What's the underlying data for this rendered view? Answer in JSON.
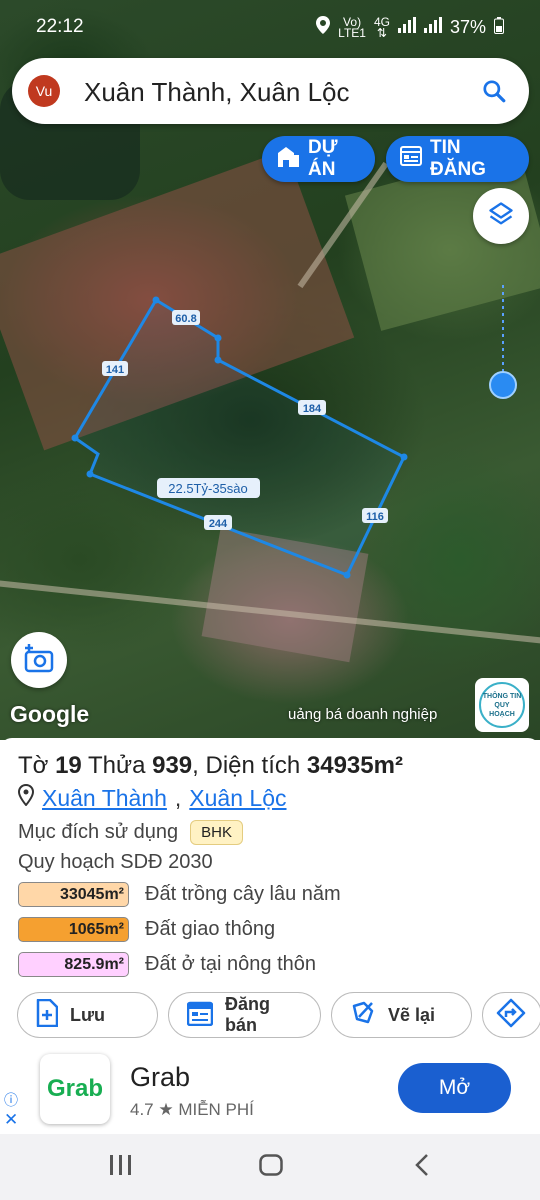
{
  "status": {
    "time": "22:12",
    "volte": "Vo)",
    "lte": "LTE1",
    "net": "4G",
    "battery": "37%"
  },
  "search": {
    "avatar": "Vu",
    "title": "Xuân Thành, Xuân Lộc",
    "icon": "search-icon"
  },
  "chips": {
    "project": "DỰ ÁN",
    "listing": "TIN ĐĂNG"
  },
  "map": {
    "edges": [
      "60.8",
      "141",
      "184",
      "116",
      "244"
    ],
    "parcel_label": "22.5Tỷ-35sào",
    "google": "Google",
    "ad_text": "uảng bá doanh nghiệp",
    "badge": "THÔNG TIN QUY HOẠCH",
    "parcel_color": "#1e88e5"
  },
  "parcel": {
    "sheet_label": "Tờ",
    "sheet": "19",
    "plot_label": "Thửa",
    "plot": "939",
    "area_label": "Diện tích",
    "area": "34935m²",
    "commune": "Xuân Thành",
    "district": "Xuân Lộc",
    "purpose_label": "Mục đích sử dụng",
    "purpose": "BHK",
    "plan_label": "Quy hoạch SDĐ 2030",
    "land_uses": [
      {
        "area": "33045m²",
        "label": "Đất trồng cây lâu năm",
        "color": "#ffd7a8"
      },
      {
        "area": "1065m²",
        "label": "Đất giao thông",
        "color": "#f5a030"
      },
      {
        "area": "825.9m²",
        "label": "Đất ở tại nông thôn",
        "color": "#ffd0ff"
      }
    ]
  },
  "actions": {
    "save": "Lưu",
    "sell": "Đăng bán",
    "redraw": "Vẽ lại"
  },
  "ad": {
    "logo": "Grab",
    "name": "Grab",
    "rating": "4.7 ★  MIỄN PHÍ",
    "open": "Mở",
    "info": "ⓘ",
    "close": "✕"
  },
  "nav": {
    "recent": "|||",
    "home": "○",
    "back": "<"
  }
}
